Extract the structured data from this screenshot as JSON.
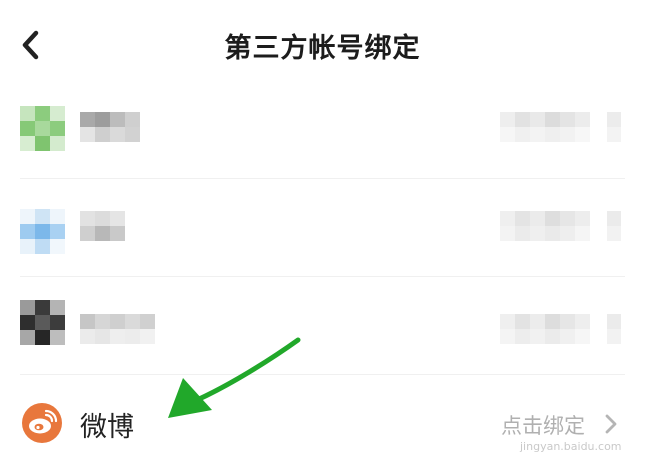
{
  "header": {
    "title": "第三方帐号绑定",
    "back_icon": "chevron-left-icon"
  },
  "accounts": [
    {
      "icon": "wechat-icon",
      "label_blurred": true,
      "status_blurred": true
    },
    {
      "icon": "account-icon",
      "label_blurred": true,
      "status_blurred": true
    },
    {
      "icon": "account-icon",
      "label_blurred": true,
      "status_blurred": true
    }
  ],
  "weibo": {
    "label": "微博",
    "status": "点击绑定",
    "icon": "weibo-icon",
    "chevron_icon": "chevron-right-icon"
  },
  "watermark": "jingyan.baidu.com",
  "colors": {
    "weibo_brand": "#e8773c",
    "annotation_arrow": "#21a82a"
  }
}
